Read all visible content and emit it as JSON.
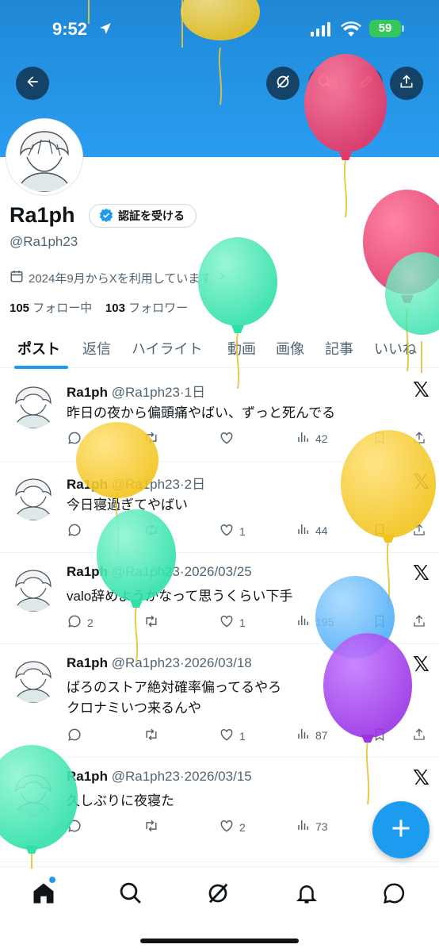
{
  "status_bar": {
    "time": "9:52",
    "battery": "59"
  },
  "profile": {
    "name": "Ra1ph",
    "verify_label": "認証を受ける",
    "handle": "@Ra1ph23",
    "joined": "2024年9月からXを利用しています",
    "following_count": "105",
    "following_label": "フォロー中",
    "followers_count": "103",
    "followers_label": "フォロワー"
  },
  "tabs": [
    "ポスト",
    "返信",
    "ハイライト",
    "動画",
    "画像",
    "記事",
    "いいね"
  ],
  "posts": [
    {
      "name": "Ra1ph",
      "handle": "@Ra1ph23",
      "sep": "·",
      "date": "1日",
      "text": [
        "昨日の夜から偏頭痛やばい、ずっと死んでる"
      ],
      "replies": "",
      "likes": "",
      "views": "42"
    },
    {
      "name": "Ra1ph",
      "handle": "@Ra1ph23",
      "sep": "·",
      "date": "2日",
      "text": [
        "今日寝過ぎてやばい"
      ],
      "replies": "",
      "likes": "1",
      "views": "44"
    },
    {
      "name": "Ra1ph",
      "handle": "@Ra1ph23",
      "sep": "·",
      "date": "2026/03/25",
      "text": [
        "valo辞めようかなって思うくらい下手"
      ],
      "replies": "2",
      "likes": "1",
      "views": "195"
    },
    {
      "name": "Ra1ph",
      "handle": "@Ra1ph23",
      "sep": "·",
      "date": "2026/03/18",
      "text": [
        "ばろのストア絶対確率偏ってるやろ",
        "クロナミいつ来るんや"
      ],
      "replies": "",
      "likes": "1",
      "views": "87"
    },
    {
      "name": "Ra1ph",
      "handle": "@Ra1ph23",
      "sep": "·",
      "date": "2026/03/15",
      "text": [
        "久しぶりに夜寝た"
      ],
      "replies": "",
      "likes": "2",
      "views": "73"
    }
  ],
  "icons": {
    "back": "arrow-left-icon",
    "grok": "grok-icon",
    "search": "search-icon",
    "edit": "pencil-icon",
    "share": "share-icon",
    "home": "home-icon",
    "explore": "search-icon",
    "notifications": "bell-icon",
    "messages": "message-icon",
    "compose": "plus-icon"
  },
  "colors": {
    "accent": "#1d9bf0",
    "banner": "#2a9df0",
    "text": "#0f1419",
    "muted": "#536471"
  }
}
